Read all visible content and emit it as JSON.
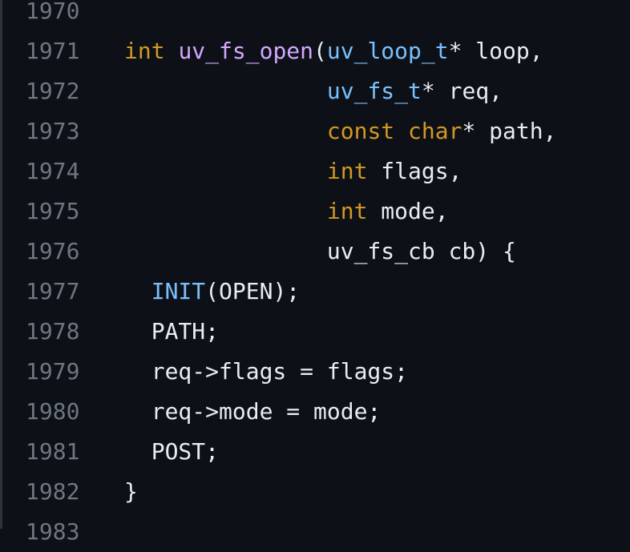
{
  "colors": {
    "background": "#0d1117",
    "line_number": "#6e7681",
    "keyword": "#d29922",
    "function": "#d2a8ff",
    "type": "#79c0ff",
    "text": "#e6edf3"
  },
  "code": {
    "lines": [
      {
        "number": "1970",
        "tokens": []
      },
      {
        "number": "1971",
        "tokens": [
          {
            "text": "int",
            "kind": "kw"
          },
          {
            "text": " ",
            "kind": "pl"
          },
          {
            "text": "uv_fs_open",
            "kind": "fn"
          },
          {
            "text": "(",
            "kind": "pl"
          },
          {
            "text": "uv_loop_t",
            "kind": "ty"
          },
          {
            "text": "* loop,",
            "kind": "pl"
          }
        ]
      },
      {
        "number": "1972",
        "tokens": [
          {
            "text": "               ",
            "kind": "pl"
          },
          {
            "text": "uv_fs_t",
            "kind": "ty"
          },
          {
            "text": "* req,",
            "kind": "pl"
          }
        ]
      },
      {
        "number": "1973",
        "tokens": [
          {
            "text": "               ",
            "kind": "pl"
          },
          {
            "text": "const",
            "kind": "kw"
          },
          {
            "text": " ",
            "kind": "pl"
          },
          {
            "text": "char",
            "kind": "kw"
          },
          {
            "text": "* path,",
            "kind": "pl"
          }
        ]
      },
      {
        "number": "1974",
        "tokens": [
          {
            "text": "               ",
            "kind": "pl"
          },
          {
            "text": "int",
            "kind": "kw"
          },
          {
            "text": " flags,",
            "kind": "pl"
          }
        ]
      },
      {
        "number": "1975",
        "tokens": [
          {
            "text": "               ",
            "kind": "pl"
          },
          {
            "text": "int",
            "kind": "kw"
          },
          {
            "text": " mode,",
            "kind": "pl"
          }
        ]
      },
      {
        "number": "1976",
        "tokens": [
          {
            "text": "               uv_fs_cb cb) {",
            "kind": "pl"
          }
        ]
      },
      {
        "number": "1977",
        "tokens": [
          {
            "text": "  ",
            "kind": "pl"
          },
          {
            "text": "INIT",
            "kind": "mc"
          },
          {
            "text": "(OPEN);",
            "kind": "pl"
          }
        ]
      },
      {
        "number": "1978",
        "tokens": [
          {
            "text": "  PATH;",
            "kind": "pl"
          }
        ]
      },
      {
        "number": "1979",
        "tokens": [
          {
            "text": "  req->flags = flags;",
            "kind": "pl"
          }
        ]
      },
      {
        "number": "1980",
        "tokens": [
          {
            "text": "  req->mode = mode;",
            "kind": "pl"
          }
        ]
      },
      {
        "number": "1981",
        "tokens": [
          {
            "text": "  POST;",
            "kind": "pl"
          }
        ]
      },
      {
        "number": "1982",
        "tokens": [
          {
            "text": "}",
            "kind": "pl"
          }
        ]
      },
      {
        "number": "1983",
        "tokens": []
      }
    ]
  }
}
